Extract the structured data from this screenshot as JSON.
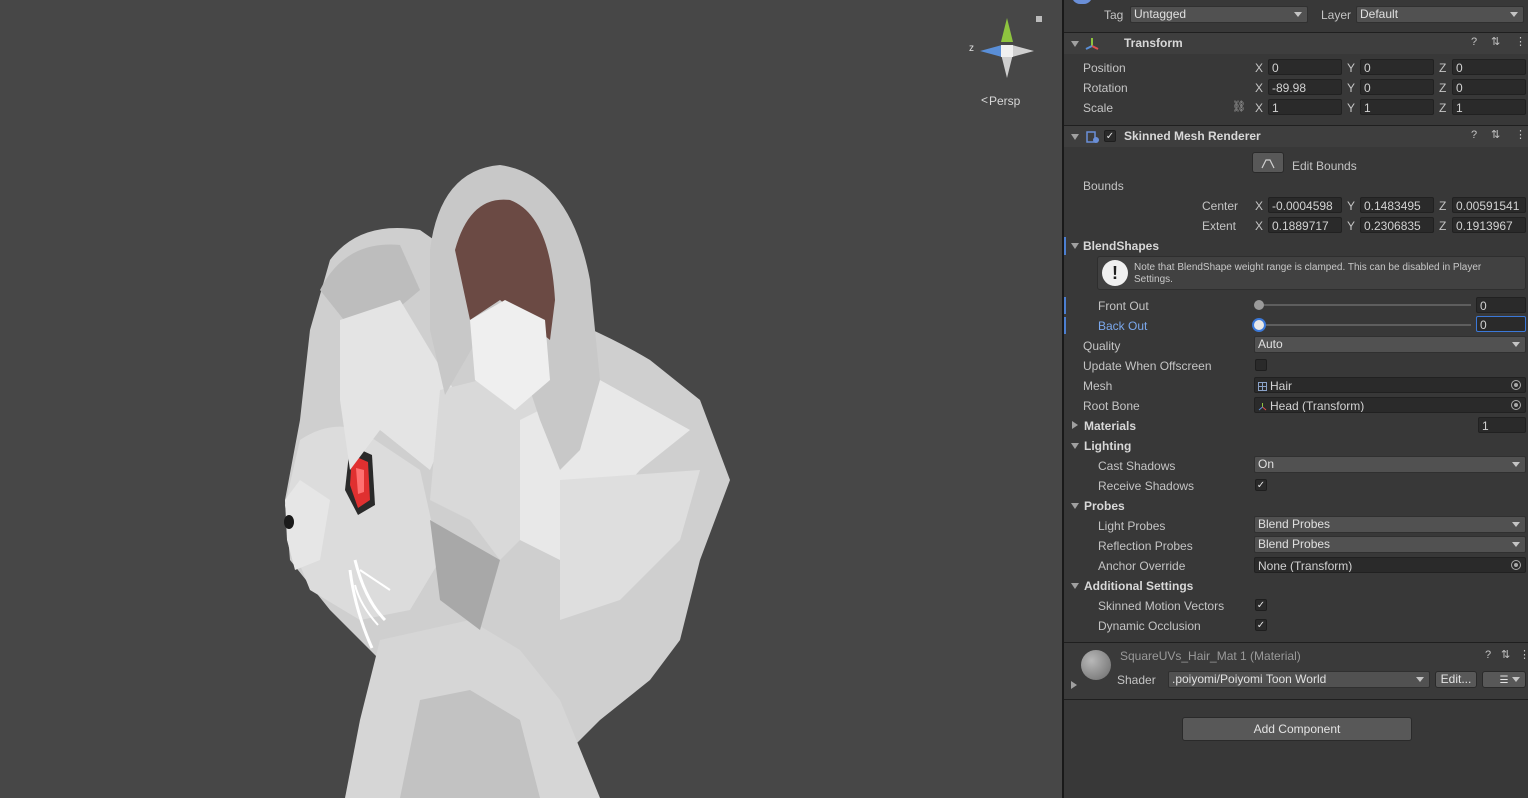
{
  "scene": {
    "gizmo": {
      "z_label": "z",
      "persp_label": "Persp"
    }
  },
  "header": {
    "tag_label": "Tag",
    "tag_value": "Untagged",
    "layer_label": "Layer",
    "layer_value": "Default"
  },
  "transform": {
    "title": "Transform",
    "position_label": "Position",
    "position": [
      "0",
      "0",
      "0"
    ],
    "rotation_label": "Rotation",
    "rotation": [
      "-89.98",
      "0",
      "0"
    ],
    "scale_label": "Scale",
    "scale": [
      "1",
      "1",
      "1"
    ],
    "axis": [
      "X",
      "Y",
      "Z"
    ]
  },
  "smr": {
    "title": "Skinned Mesh Renderer",
    "edit_bounds": "Edit Bounds",
    "bounds_label": "Bounds",
    "center_label": "Center",
    "center": [
      "-0.0004598",
      "0.1483495",
      "0.00591541"
    ],
    "extent_label": "Extent",
    "extent": [
      "0.1889717",
      "0.2306835",
      "0.1913967"
    ],
    "blendshapes_label": "BlendShapes",
    "note": "Note that BlendShape weight range is clamped. This can be disabled in Player Settings.",
    "front_out_label": "Front Out",
    "front_out_value": "0",
    "back_out_label": "Back Out",
    "back_out_value": "0",
    "quality_label": "Quality",
    "quality_value": "Auto",
    "update_offscreen_label": "Update When Offscreen",
    "mesh_label": "Mesh",
    "mesh_value": "Hair",
    "root_bone_label": "Root Bone",
    "root_bone_value": "Head (Transform)",
    "materials_label": "Materials",
    "materials_count": "1",
    "lighting_label": "Lighting",
    "cast_shadows_label": "Cast Shadows",
    "cast_shadows_value": "On",
    "receive_shadows_label": "Receive Shadows",
    "probes_label": "Probes",
    "light_probes_label": "Light Probes",
    "light_probes_value": "Blend Probes",
    "reflection_probes_label": "Reflection Probes",
    "reflection_probes_value": "Blend Probes",
    "anchor_override_label": "Anchor Override",
    "anchor_override_value": "None (Transform)",
    "additional_label": "Additional Settings",
    "motion_vectors_label": "Skinned Motion Vectors",
    "dynamic_occlusion_label": "Dynamic Occlusion"
  },
  "material": {
    "title": "SquareUVs_Hair_Mat 1 (Material)",
    "shader_label": "Shader",
    "shader_value": ".poiyomi/Poiyomi Toon World",
    "edit_label": "Edit..."
  },
  "add_component": "Add Component",
  "colors": {
    "accent": "#4c7fd1",
    "bg": "#383838",
    "scene_bg": "#474747"
  }
}
